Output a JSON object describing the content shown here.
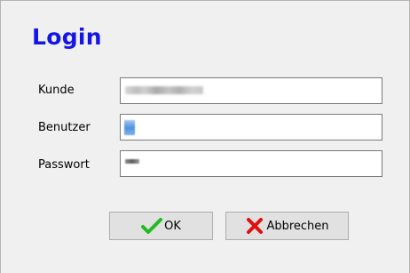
{
  "dialog": {
    "title": "Login"
  },
  "form": {
    "customer_label": "Kunde",
    "user_label": "Benutzer",
    "password_label": "Passwort"
  },
  "buttons": {
    "ok_label": "OK",
    "cancel_label": "Abbrechen",
    "ok_icon": "checkmark-icon",
    "cancel_icon": "red-x-icon"
  },
  "colors": {
    "title": "#1515e6",
    "ok_icon": "#22bb22",
    "cancel_icon": "#e01010"
  }
}
